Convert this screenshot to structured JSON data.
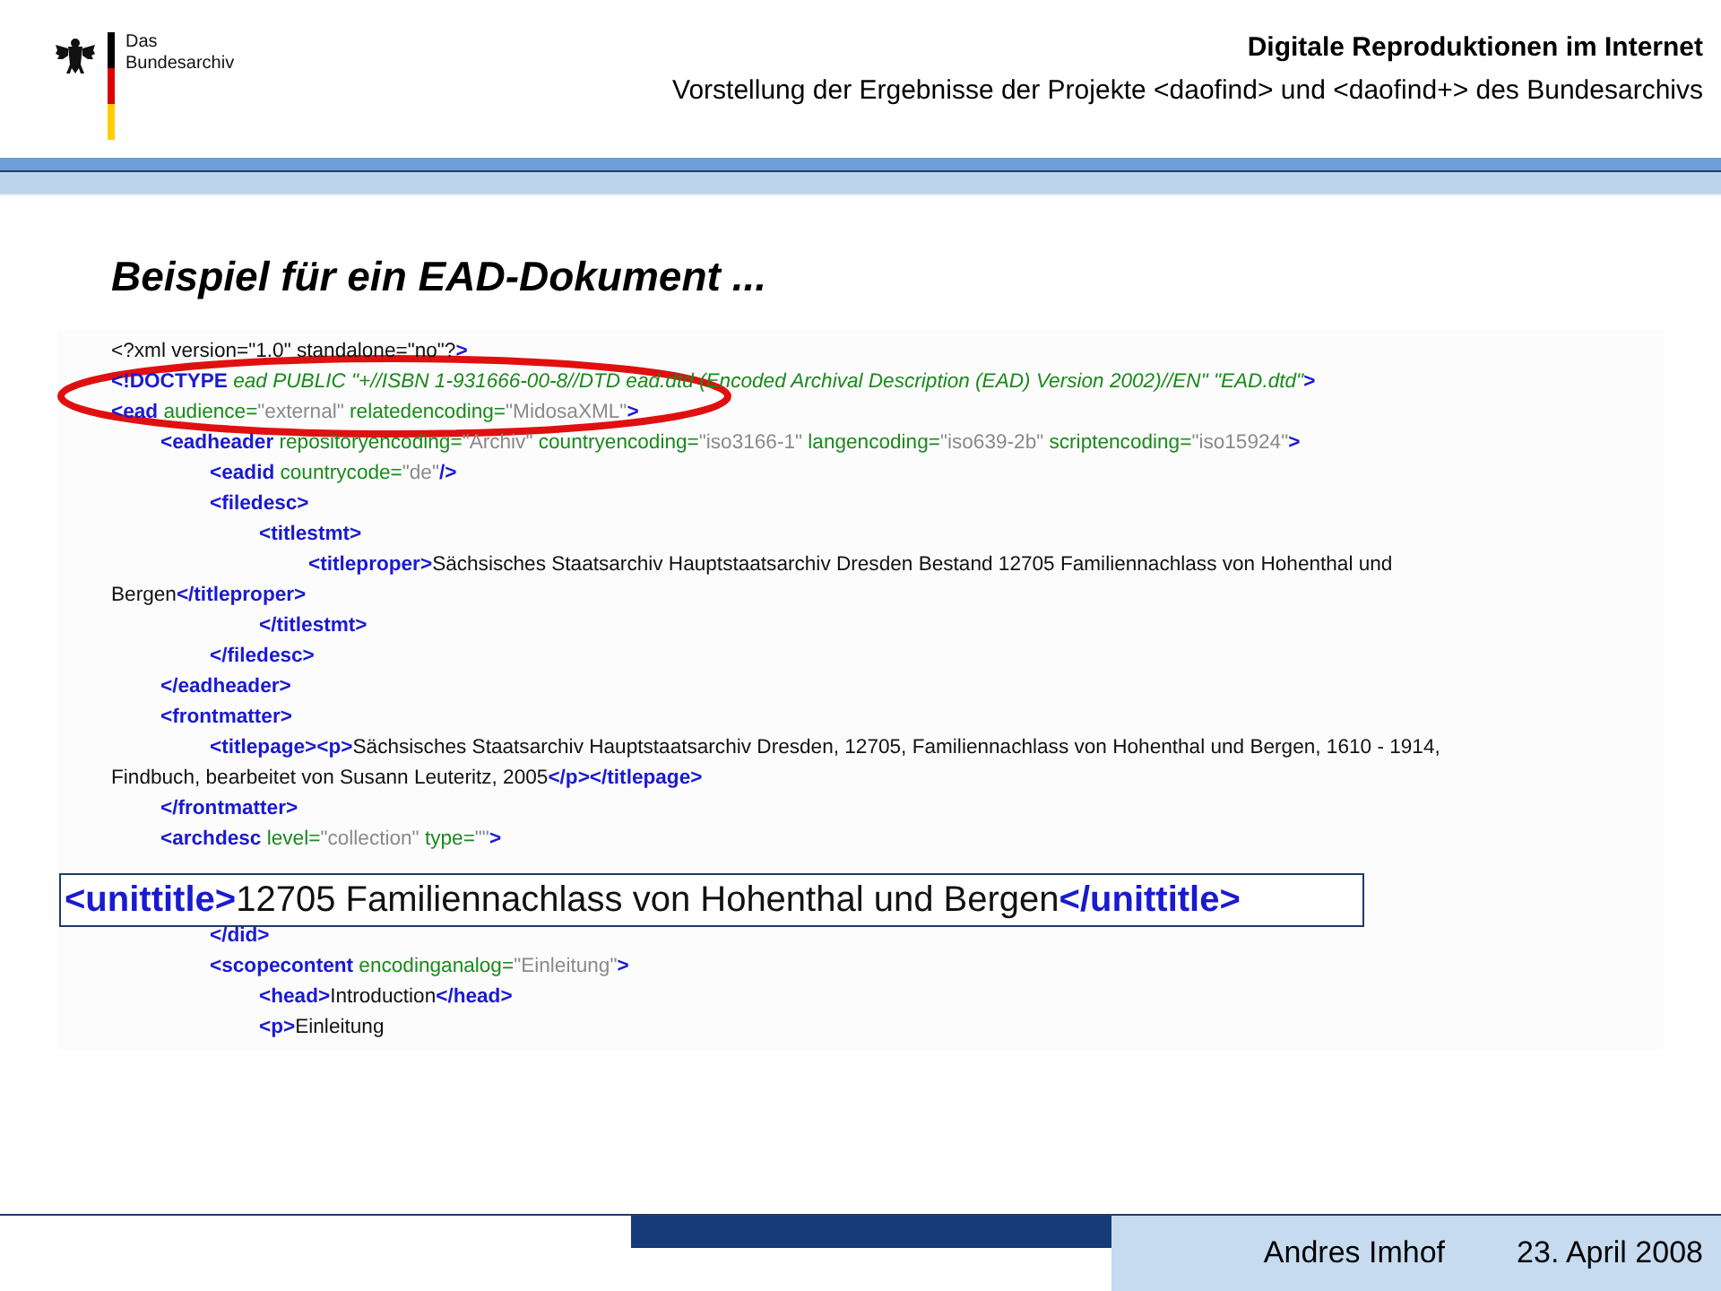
{
  "logo": {
    "line_1": "Das",
    "line_2": "Bundesarchiv"
  },
  "header": {
    "title": "Digitale Reproduktionen im Internet",
    "subtitle": "Vorstellung der Ergebnisse der Projekte <daofind> und <daofind+> des Bundesarchivs"
  },
  "slide_title": "Beispiel für ein EAD-Dokument ...",
  "code": [
    {
      "tokens": [
        {
          "kind": "pi",
          "text": "<?xml version=\"1.0\" standalone=\"no\"?"
        },
        {
          "kind": "tag",
          "text": ">"
        }
      ]
    },
    {
      "tokens": [
        {
          "kind": "tag",
          "text": "<!DOCTYPE"
        },
        {
          "kind": "doctype",
          "text": " ead PUBLIC \"+//ISBN 1-931666-00-8//DTD ead.dtd (Encoded Archival Description (EAD) Version 2002)//EN\" \"EAD.dtd\""
        },
        {
          "kind": "tag",
          "text": ">"
        }
      ]
    },
    {
      "tokens": [
        {
          "kind": "tag",
          "text": "<ead"
        },
        {
          "kind": "attr",
          "text": " audience="
        },
        {
          "kind": "val",
          "text": "\"external\""
        },
        {
          "kind": "attr",
          "text": " relatedencoding="
        },
        {
          "kind": "val",
          "text": "\"MidosaXML\""
        },
        {
          "kind": "tag",
          "text": ">"
        }
      ],
      "children": [
        {
          "tokens": [
            {
              "kind": "tag",
              "text": "<eadheader"
            },
            {
              "kind": "attr",
              "text": " repositoryencoding="
            },
            {
              "kind": "val",
              "text": "\"Archiv\""
            },
            {
              "kind": "attr",
              "text": " countryencoding="
            },
            {
              "kind": "val",
              "text": "\"iso3166-1\""
            },
            {
              "kind": "attr",
              "text": " langencoding="
            },
            {
              "kind": "val",
              "text": "\"iso639-2b\""
            },
            {
              "kind": "attr",
              "text": " scriptencoding="
            },
            {
              "kind": "val",
              "text": "\"iso15924\""
            },
            {
              "kind": "tag",
              "text": ">"
            }
          ],
          "children": [
            {
              "tokens": [
                {
                  "kind": "tag",
                  "text": "<eadid"
                },
                {
                  "kind": "attr",
                  "text": " countrycode="
                },
                {
                  "kind": "val",
                  "text": "\"de\""
                },
                {
                  "kind": "tag",
                  "text": "/>"
                }
              ]
            },
            {
              "tokens": [
                {
                  "kind": "tag",
                  "text": "<filedesc>"
                }
              ],
              "children": [
                {
                  "tokens": [
                    {
                      "kind": "tag",
                      "text": "<titlestmt>"
                    }
                  ],
                  "children": [
                    {
                      "tokens": [
                        {
                          "kind": "tag",
                          "text": "<titleproper>"
                        },
                        {
                          "kind": "text",
                          "text": "Sächsisches Staatsarchiv Hauptstaatsarchiv Dresden Bestand 12705 Familiennachlass von Hohenthal und"
                        }
                      ],
                      "wrap": [
                        {
                          "kind": "text",
                          "text": "Bergen"
                        },
                        {
                          "kind": "tag",
                          "text": "</titleproper>"
                        }
                      ]
                    }
                  ]
                },
                {
                  "tokens": [
                    {
                      "kind": "tag",
                      "text": "</titlestmt>"
                    }
                  ]
                }
              ]
            },
            {
              "tokens": [
                {
                  "kind": "tag",
                  "text": "</filedesc>"
                }
              ]
            }
          ]
        },
        {
          "tokens": [
            {
              "kind": "tag",
              "text": "</eadheader>"
            }
          ]
        },
        {
          "tokens": [
            {
              "kind": "tag",
              "text": "<frontmatter>"
            }
          ],
          "children": [
            {
              "tokens": [
                {
                  "kind": "tag",
                  "text": "<titlepage><p>"
                },
                {
                  "kind": "text",
                  "text": "Sächsisches Staatsarchiv Hauptstaatsarchiv Dresden, 12705, Familiennachlass von Hohenthal und Bergen, 1610 - 1914,"
                }
              ],
              "wrap": [
                {
                  "kind": "text",
                  "text": "Findbuch, bearbeitet von Susann Leuteritz, 2005"
                },
                {
                  "kind": "tag",
                  "text": "</p></titlepage>"
                }
              ]
            }
          ]
        },
        {
          "tokens": [
            {
              "kind": "tag",
              "text": "</frontmatter>"
            }
          ]
        },
        {
          "tokens": [
            {
              "kind": "tag",
              "text": "<archdesc"
            },
            {
              "kind": "attr",
              "text": " level="
            },
            {
              "kind": "val",
              "text": "\"collection\""
            },
            {
              "kind": "attr",
              "text": " type="
            },
            {
              "kind": "val",
              "text": "\"\""
            },
            {
              "kind": "tag",
              "text": ">"
            }
          ],
          "highlight": [
            {
              "kind": "tag",
              "text": "<unittitle>"
            },
            {
              "kind": "text",
              "text": "12705 Familiennachlass von Hohenthal und Bergen"
            },
            {
              "kind": "tag",
              "text": "</unittitle>"
            }
          ],
          "children": [
            {
              "tokens": [
                {
                  "kind": "tag",
                  "text": "</did>"
                }
              ]
            },
            {
              "tokens": [
                {
                  "kind": "tag",
                  "text": "<scopecontent"
                },
                {
                  "kind": "attr",
                  "text": " encodinganalog="
                },
                {
                  "kind": "val",
                  "text": "\"Einleitung\""
                },
                {
                  "kind": "tag",
                  "text": ">"
                }
              ],
              "children": [
                {
                  "tokens": [
                    {
                      "kind": "tag",
                      "text": "<head>"
                    },
                    {
                      "kind": "text",
                      "text": "Introduction"
                    },
                    {
                      "kind": "tag",
                      "text": "</head>"
                    }
                  ]
                },
                {
                  "tokens": [
                    {
                      "kind": "tag",
                      "text": "<p>"
                    },
                    {
                      "kind": "text",
                      "text": "Einleitung"
                    }
                  ]
                }
              ]
            }
          ]
        }
      ]
    }
  ],
  "footer": {
    "author": "Andres Imhof",
    "date": "23. April 2008"
  }
}
